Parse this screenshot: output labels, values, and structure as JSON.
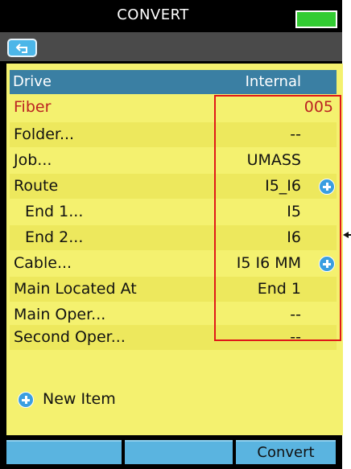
{
  "window": {
    "title": "CONVERT"
  },
  "colors": {
    "panel": "#f4f16f",
    "header": "#3a7fa3",
    "accent": "#5ab4e0",
    "highlight": "#e01818",
    "fiber": "#bb2222"
  },
  "header": {
    "label": "Drive",
    "value": "Internal"
  },
  "fields": [
    {
      "label": "Fiber",
      "value": "005"
    },
    {
      "label": "Folder...",
      "value": "--"
    },
    {
      "label": "Job...",
      "value": "UMASS"
    },
    {
      "label": "Route",
      "value": "I5_I6",
      "icon": "plus-icon"
    },
    {
      "label": "End 1...",
      "value": "I5"
    },
    {
      "label": "End 2...",
      "value": "I6"
    },
    {
      "label": "Cable...",
      "value": "I5 I6 MM",
      "icon": "plus-icon"
    },
    {
      "label": "Main Located At",
      "value": "End 1"
    },
    {
      "label": "Main Oper...",
      "value": "--"
    },
    {
      "label": "Second Oper...",
      "value": "--"
    }
  ],
  "new_item": {
    "label": "New Item",
    "icon": "plus-icon"
  },
  "softkeys": [
    "",
    "",
    "",
    "Convert"
  ],
  "icons": {
    "back": "back-arrow-icon",
    "battery": "battery-icon",
    "pointer": "pointer-arrow-icon"
  }
}
